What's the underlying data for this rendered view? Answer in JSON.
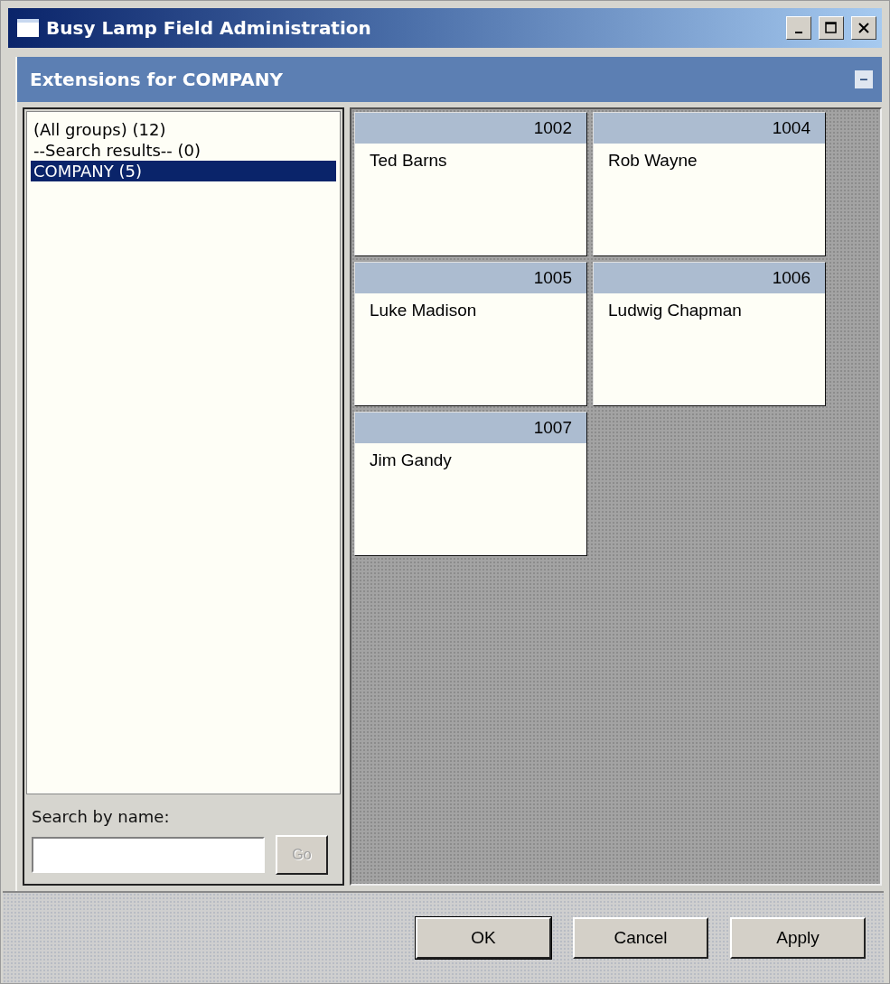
{
  "window": {
    "title": "Busy Lamp Field Administration"
  },
  "panel": {
    "title": "Extensions for COMPANY",
    "collapse_glyph": "–"
  },
  "groups": [
    {
      "label": "(All groups) (12)",
      "selected": false
    },
    {
      "label": "--Search results-- (0)",
      "selected": false
    },
    {
      "label": "COMPANY (5)",
      "selected": true
    }
  ],
  "search": {
    "label": "Search by name:",
    "button": {
      "label": "Go",
      "disabled": true
    }
  },
  "extensions": [
    {
      "number": "1002",
      "name": "Ted Barns"
    },
    {
      "number": "1004",
      "name": "Rob Wayne"
    },
    {
      "number": "1005",
      "name": "Luke Madison"
    },
    {
      "number": "1006",
      "name": "Ludwig Chapman"
    },
    {
      "number": "1007",
      "name": "Jim Gandy"
    }
  ],
  "buttons": [
    "OK",
    "Cancel",
    "Apply"
  ]
}
